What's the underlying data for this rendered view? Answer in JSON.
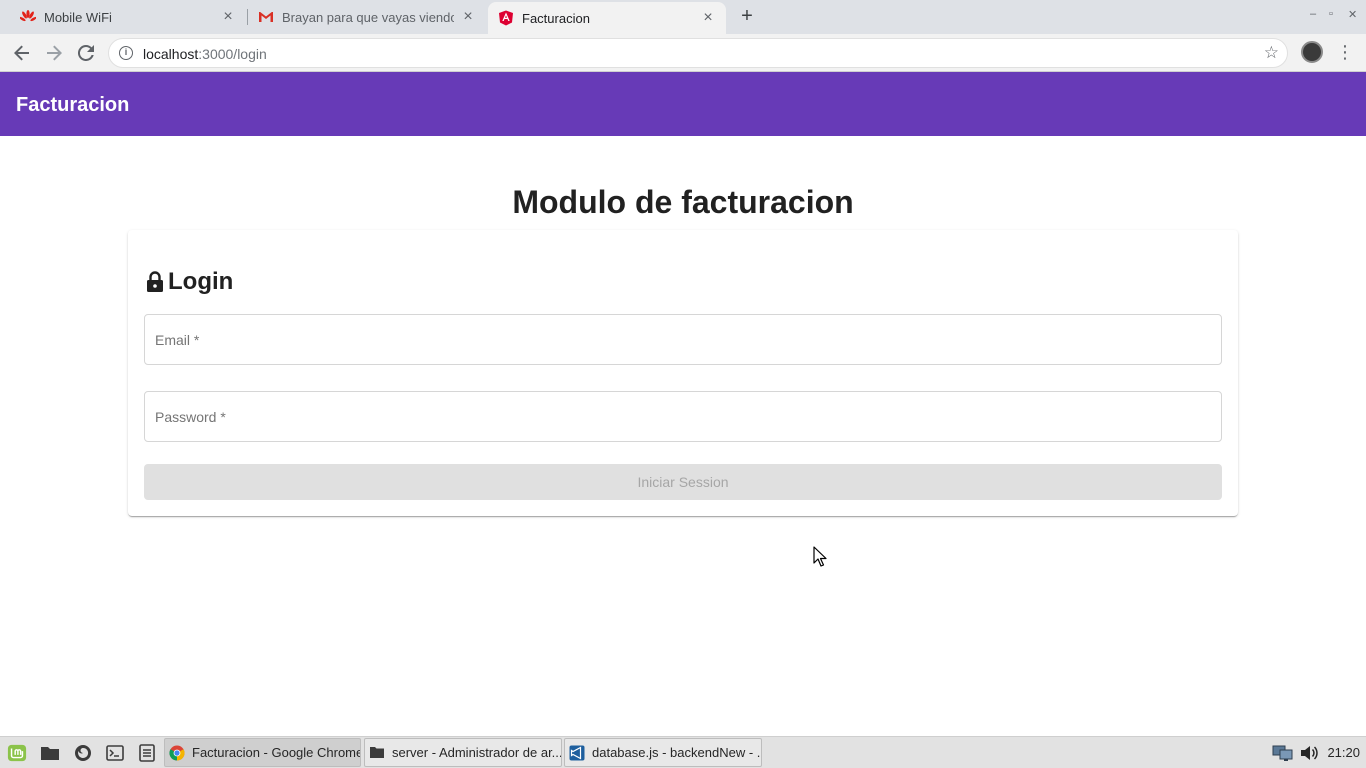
{
  "browser": {
    "tabs": [
      {
        "title": "Mobile WiFi",
        "icon": "huawei-icon",
        "active": false
      },
      {
        "title": "Brayan para que vayas viendo",
        "icon": "gmail-icon",
        "active": false
      },
      {
        "title": "Facturacion",
        "icon": "angular-icon",
        "active": true
      }
    ],
    "url_host": "localhost",
    "url_path": ":3000/login"
  },
  "app": {
    "brand": "Facturacion",
    "brand_color": "#673ab7",
    "page_title": "Modulo de facturacion",
    "login": {
      "title": "Login",
      "email_placeholder": "Email *",
      "password_placeholder": "Password *",
      "submit_label": "Iniciar Session",
      "submit_disabled": true
    }
  },
  "taskbar": {
    "tasks": [
      {
        "label": "Facturacion - Google Chrome",
        "icon": "chrome-icon",
        "active": true
      },
      {
        "label": "server - Administrador de ar...",
        "icon": "folder-icon",
        "active": false
      },
      {
        "label": "database.js - backendNew - ...",
        "icon": "vscode-icon",
        "active": false
      }
    ],
    "clock": "21:20"
  }
}
